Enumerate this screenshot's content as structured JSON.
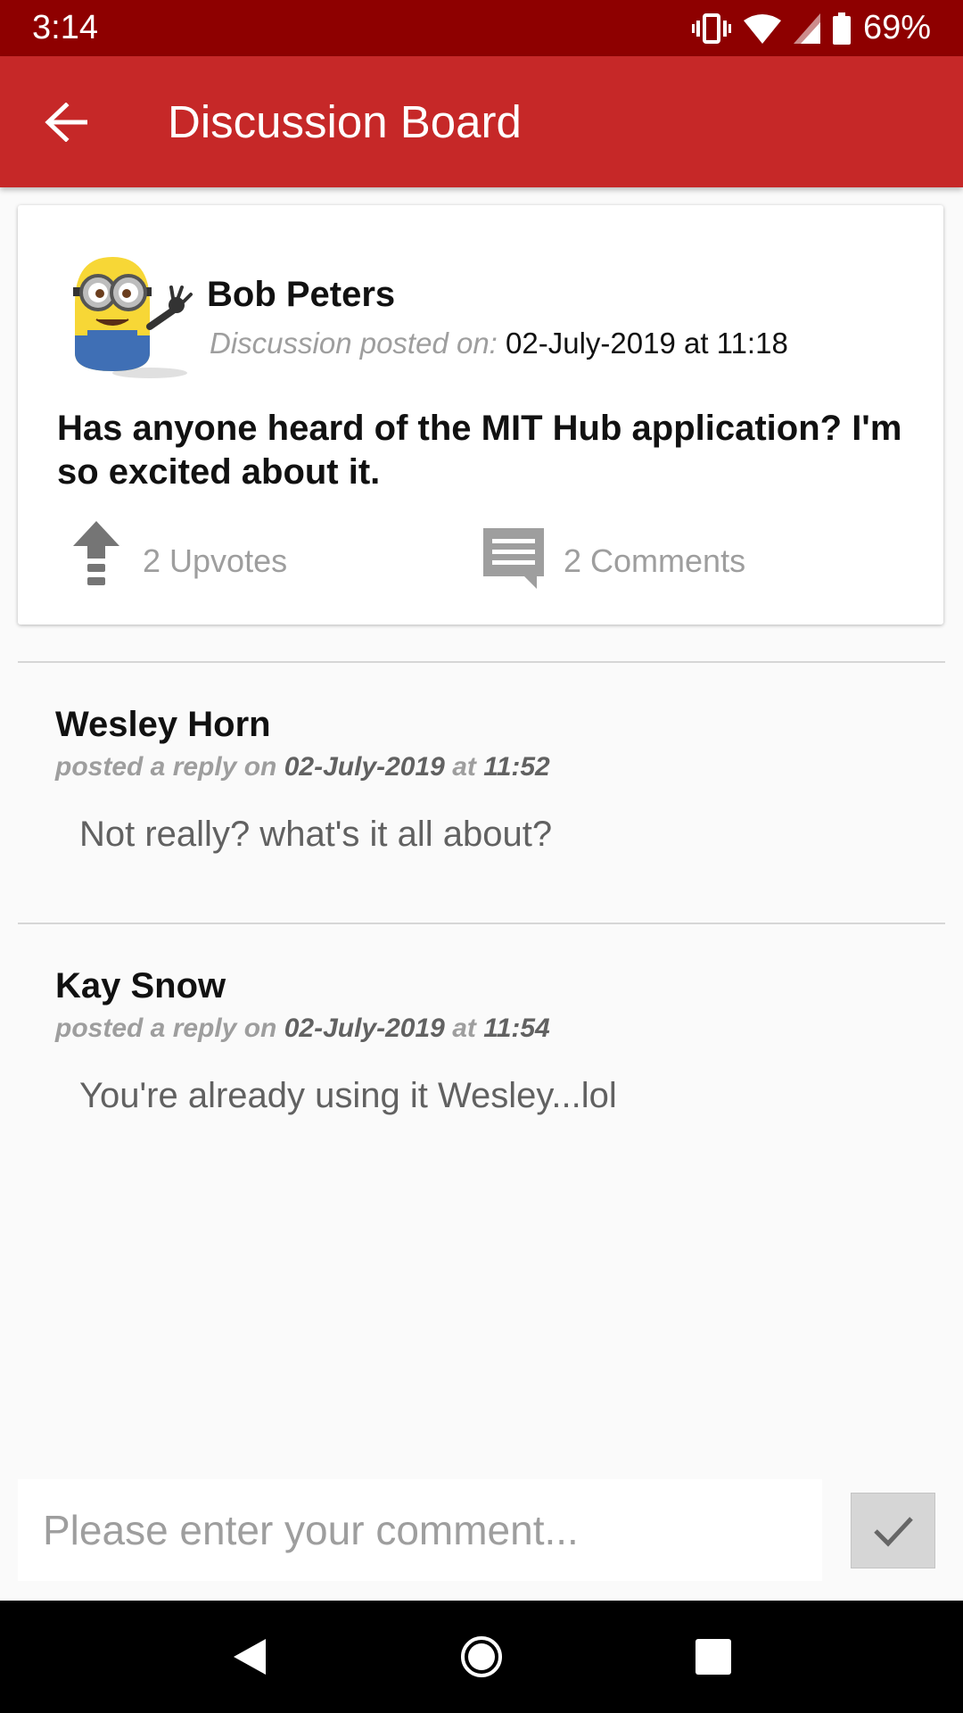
{
  "status_bar": {
    "time": "3:14",
    "battery": "69%"
  },
  "app_bar": {
    "title": "Discussion Board"
  },
  "post": {
    "author": "Bob Peters",
    "posted_label": "Discussion posted on:",
    "posted_value": "02-July-2019 at 11:18",
    "body": "Has anyone heard of the MIT Hub application? I'm so excited about it.",
    "upvotes": "2 Upvotes",
    "comments": "2 Comments"
  },
  "replies": [
    {
      "author": "Wesley Horn",
      "meta_prefix": "posted a reply on",
      "date": "02-July-2019",
      "at": "at",
      "time": "11:52",
      "text": "Not really? what's it all about?"
    },
    {
      "author": "Kay Snow",
      "meta_prefix": "posted a reply on",
      "date": "02-July-2019",
      "at": "at",
      "time": "11:54",
      "text": "You're already using it Wesley...lol"
    }
  ],
  "comment_box": {
    "placeholder": "Please enter your comment..."
  },
  "colors": {
    "status_bar": "#8e0000",
    "app_bar": "#c62828",
    "muted": "#9e9e9e"
  },
  "icons": [
    "back-arrow-icon",
    "vibrate-icon",
    "wifi-icon",
    "signal-icon",
    "battery-icon",
    "upvote-arrow-icon",
    "comment-icon",
    "check-icon",
    "nav-back-icon",
    "nav-home-icon",
    "nav-recents-icon"
  ]
}
